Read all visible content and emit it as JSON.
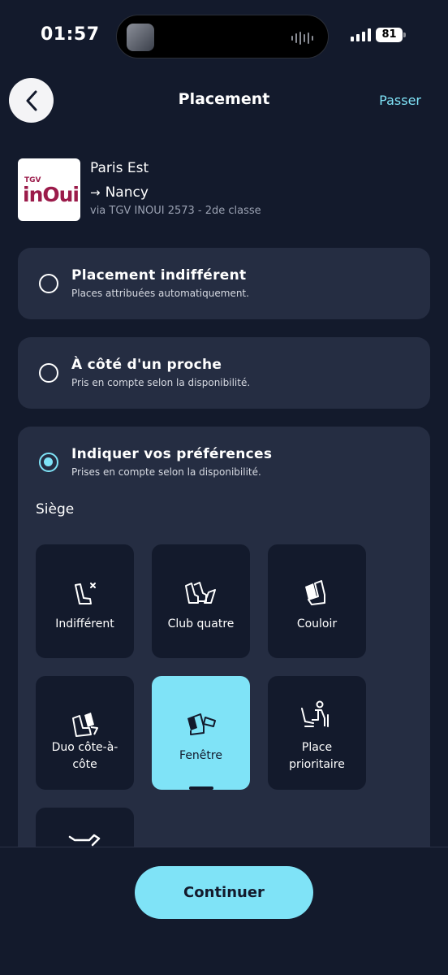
{
  "status_bar": {
    "time": "01:57",
    "battery": "81"
  },
  "header": {
    "title": "Placement",
    "skip_label": "Passer"
  },
  "trip": {
    "logo_tgv": "TGV",
    "logo_inoui": "inOui",
    "from": "Paris Est",
    "to": "Nancy",
    "arrow": "→",
    "via": "via TGV INOUI 2573 - 2de classe"
  },
  "options": [
    {
      "title": "Placement indifférent",
      "subtitle": "Places attribuées automatiquement.",
      "selected": false
    },
    {
      "title": "À côté d'un proche",
      "subtitle": "Pris en compte selon la disponibilité.",
      "selected": false
    },
    {
      "title": "Indiquer vos préférences",
      "subtitle": "Prises en compte selon la disponibilité.",
      "selected": true
    }
  ],
  "seat_section": {
    "label": "Siège",
    "tiles": [
      {
        "label": "Indifférent",
        "icon": "seat-any-icon"
      },
      {
        "label": "Club quatre",
        "icon": "seat-club-icon"
      },
      {
        "label": "Couloir",
        "icon": "seat-aisle-icon"
      },
      {
        "label_line1": "Duo côte-à-",
        "label_line2": "côte",
        "icon": "seat-duo-icon"
      },
      {
        "label": "Fenêtre",
        "icon": "seat-window-icon",
        "selected": true
      },
      {
        "label_line1": "Place",
        "label_line2": "prioritaire",
        "icon": "priority-seat-icon"
      }
    ]
  },
  "footer": {
    "continue_label": "Continuer"
  },
  "colors": {
    "background": "#131a2c",
    "card": "#252d42",
    "accent": "#7fe3f7"
  }
}
